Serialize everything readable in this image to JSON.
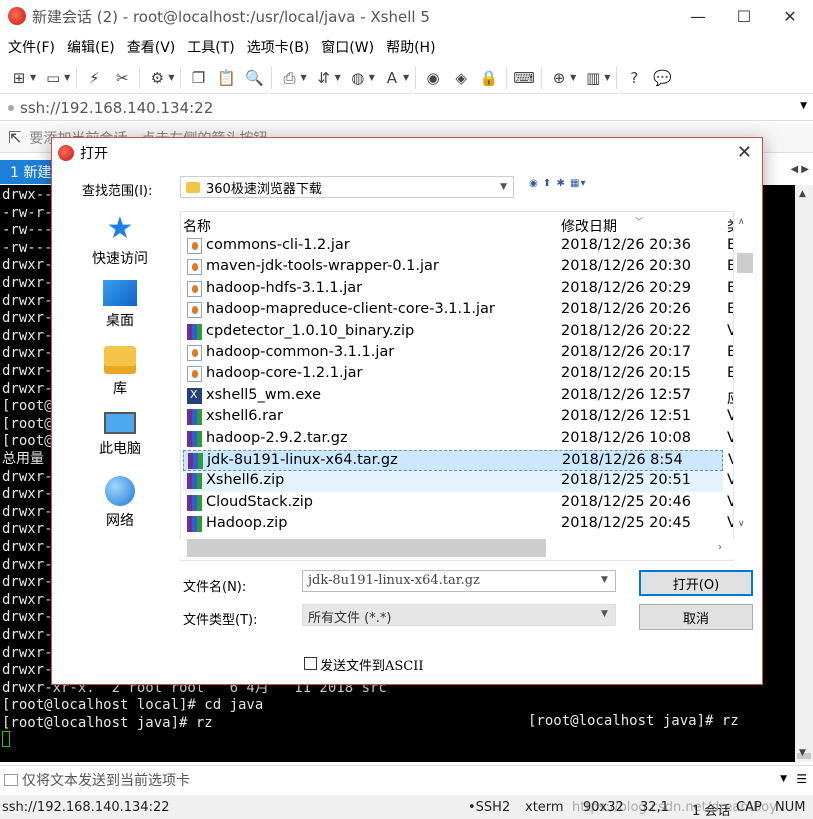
{
  "window": {
    "title": "新建会话 (2) - root@localhost:/usr/local/java - Xshell 5",
    "minimize": "—",
    "maximize": "☐",
    "close": "✕"
  },
  "menu": [
    "文件(F)",
    "编辑(E)",
    "查看(V)",
    "工具(T)",
    "选项卡(B)",
    "窗口(W)",
    "帮助(H)"
  ],
  "address": {
    "text": "ssh://192.168.140.134:22"
  },
  "hint": {
    "text": "要添加当前会话，点击左侧的箭头按钮。"
  },
  "tab": {
    "label": "1 新建"
  },
  "terminal": {
    "lines": [
      "drwx--",
      "-rw-r-",
      "-rw---",
      "-rw---",
      "drwxr-",
      "drwxr-",
      "drwxr-",
      "drwxr-",
      "drwxr-",
      "drwxr-",
      "drwxr-",
      "drwxr-",
      "[root@",
      "[root@",
      "[root@",
      "总用量",
      "drwxr-",
      "drwxr-",
      "drwxr-",
      "drwxr-",
      "drwxr-",
      "drwxr-",
      "drwxr-",
      "drwxr-",
      "drwxr-",
      "drwxr-",
      "drwxr-",
      "drwxr-",
      "drwxr-xr-x.  2 root root   6 4月   11 2018 src",
      "[root@localhost local]# cd java",
      "[root@localhost java]# rz"
    ],
    "right_text": "[root@localhost java]# rz"
  },
  "send_bar": {
    "text": "仅将文本发送到当前选项卡"
  },
  "status": {
    "address": "ssh://192.168.140.134:22",
    "protocol": "SSH2",
    "term": "xterm",
    "size": "90x32",
    "pos": "32,1",
    "sessions": "1 会话",
    "caps": "CAP",
    "num": "NUM",
    "watermark": "https://blog.csdn.net/dreamboy"
  },
  "dialog": {
    "title": "打开",
    "lookin_label": "查找范围(I):",
    "lookin_value": "360极速浏览器下载",
    "places": [
      {
        "label": "快速访问",
        "icon": "quick-access-icon"
      },
      {
        "label": "桌面",
        "icon": "desktop-icon"
      },
      {
        "label": "库",
        "icon": "library-icon"
      },
      {
        "label": "此电脑",
        "icon": "this-pc-icon"
      },
      {
        "label": "网络",
        "icon": "network-icon"
      }
    ],
    "columns": {
      "name": "名称",
      "date": "修改日期",
      "type": "类"
    },
    "files": [
      {
        "name": "commons-cli-1.2.jar",
        "date": "2018/12/26 20:36",
        "type": "E",
        "icon": "jar"
      },
      {
        "name": "maven-jdk-tools-wrapper-0.1.jar",
        "date": "2018/12/26 20:30",
        "type": "E",
        "icon": "jar"
      },
      {
        "name": "hadoop-hdfs-3.1.1.jar",
        "date": "2018/12/26 20:29",
        "type": "E",
        "icon": "jar"
      },
      {
        "name": "hadoop-mapreduce-client-core-3.1.1.jar",
        "date": "2018/12/26 20:26",
        "type": "E",
        "icon": "jar"
      },
      {
        "name": "cpdetector_1.0.10_binary.zip",
        "date": "2018/12/26 20:22",
        "type": "V",
        "icon": "zip"
      },
      {
        "name": "hadoop-common-3.1.1.jar",
        "date": "2018/12/26 20:17",
        "type": "E",
        "icon": "jar"
      },
      {
        "name": "hadoop-core-1.2.1.jar",
        "date": "2018/12/26 20:15",
        "type": "E",
        "icon": "jar"
      },
      {
        "name": "xshell5_wm.exe",
        "date": "2018/12/26 12:57",
        "type": "应",
        "icon": "exe"
      },
      {
        "name": "xshell6.rar",
        "date": "2018/12/26 12:51",
        "type": "V",
        "icon": "zip"
      },
      {
        "name": "hadoop-2.9.2.tar.gz",
        "date": "2018/12/26 10:08",
        "type": "V",
        "icon": "zip"
      },
      {
        "name": "jdk-8u191-linux-x64.tar.gz",
        "date": "2018/12/26 8:54",
        "type": "V",
        "icon": "zip",
        "selected": true
      },
      {
        "name": "Xshell6.zip",
        "date": "2018/12/25 20:51",
        "type": "V",
        "icon": "zip",
        "hover": true
      },
      {
        "name": "CloudStack.zip",
        "date": "2018/12/25 20:46",
        "type": "V",
        "icon": "zip"
      },
      {
        "name": "Hadoop.zip",
        "date": "2018/12/25 20:45",
        "type": "V",
        "icon": "zip"
      }
    ],
    "filename_label": "文件名(N):",
    "filename_value": "jdk-8u191-linux-x64.tar.gz",
    "filetype_label": "文件类型(T):",
    "filetype_value": "所有文件 (*.*)",
    "open_button": "打开(O)",
    "cancel_button": "取消",
    "ascii_label": "发送文件到ASCII"
  },
  "colors": {
    "accent": "#1c7fd8",
    "selection": "#cce8ff",
    "dialog_border": "#c6534e",
    "cursor": "#1ec51e"
  }
}
